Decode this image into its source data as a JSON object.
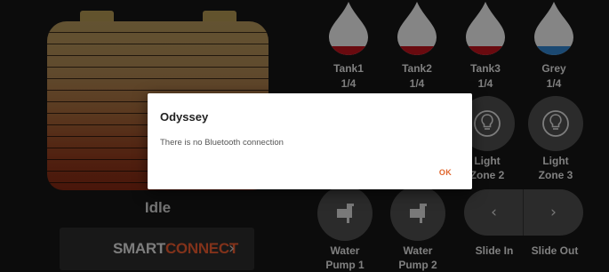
{
  "battery": {
    "status": "Idle"
  },
  "smartconnect": {
    "brand_part1": "SMART",
    "brand_part2": "CONNECT",
    "chevron": "›",
    "chevron_icon": "chevron-right-icon"
  },
  "tanks": [
    {
      "name": "Tank1",
      "level": "1/4",
      "color": "#b5121b"
    },
    {
      "name": "Tank2",
      "level": "1/4",
      "color": "#b5121b"
    },
    {
      "name": "Tank3",
      "level": "1/4",
      "color": "#b5121b"
    },
    {
      "name": "Grey",
      "level": "1/4",
      "color": "#2f7fc4"
    }
  ],
  "lights": [
    {
      "line1": "Light",
      "line2": "Zone 2",
      "icon": "lightbulb-icon"
    },
    {
      "line1": "Light",
      "line2": "Zone 3",
      "icon": "lightbulb-icon"
    }
  ],
  "pumps": [
    {
      "line1": "Water",
      "line2": "Pump 1",
      "icon": "faucet-icon"
    },
    {
      "line1": "Water",
      "line2": "Pump 2",
      "icon": "faucet-icon"
    }
  ],
  "slide": {
    "in_label": "Slide In",
    "out_label": "Slide Out",
    "in_glyph": "‹",
    "out_glyph": "›"
  },
  "dialog": {
    "title": "Odyssey",
    "message": "There is no Bluetooth connection",
    "ok_label": "OK"
  },
  "colors": {
    "accent": "#e0562e",
    "button_bg": "#4b4b4b",
    "background": "#161616"
  }
}
